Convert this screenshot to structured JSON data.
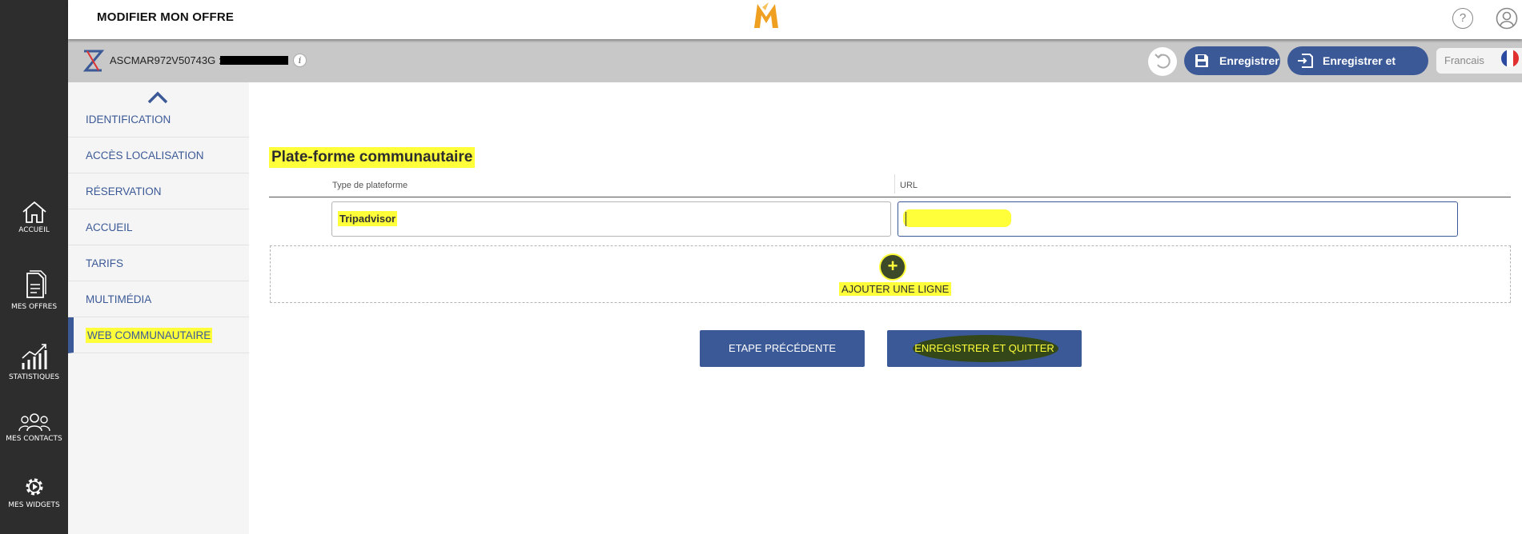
{
  "header": {
    "page_title": "MODIFIER MON OFFRE",
    "help_symbol": "?"
  },
  "subbar": {
    "offer_code": "ASCMAR972V50743G :",
    "info_symbol": "i",
    "save_label": "Enregistrer",
    "save_quit_label": "Enregistrer et quitter",
    "language": "Francais"
  },
  "rail": {
    "items": [
      {
        "label": "ACCUEIL",
        "icon": "home-icon"
      },
      {
        "label": "MES OFFRES",
        "icon": "documents-icon"
      },
      {
        "label": "STATISTIQUES",
        "icon": "bar-chart-icon"
      },
      {
        "label": "MES CONTACTS",
        "icon": "contacts-icon"
      },
      {
        "label": "MES WIDGETS",
        "icon": "gear-icon"
      }
    ]
  },
  "sidebar": {
    "items": [
      {
        "label": "IDENTIFICATION"
      },
      {
        "label": "ACCÈS LOCALISATION"
      },
      {
        "label": "RÉSERVATION"
      },
      {
        "label": "ACCUEIL"
      },
      {
        "label": "TARIFS"
      },
      {
        "label": "MULTIMÉDIA"
      },
      {
        "label": "WEB COMMUNAUTAIRE"
      }
    ]
  },
  "main": {
    "section_title": "Plate-forme communautaire",
    "col_type": "Type de plateforme",
    "col_url": "URL",
    "row": {
      "type_value": "Tripadvisor",
      "url_value": ""
    },
    "add_plus": "+",
    "add_label": "AJOUTER UNE LIGNE",
    "prev_button": "ETAPE PRÉCÉDENTE",
    "save_quit_button": "ENREGISTRER ET QUITTER"
  },
  "colors": {
    "brand_blue": "#3b5997",
    "rail_bg": "#2d2d2d",
    "highlight": "#ffff3a",
    "logo_orange": "#f0a020"
  }
}
